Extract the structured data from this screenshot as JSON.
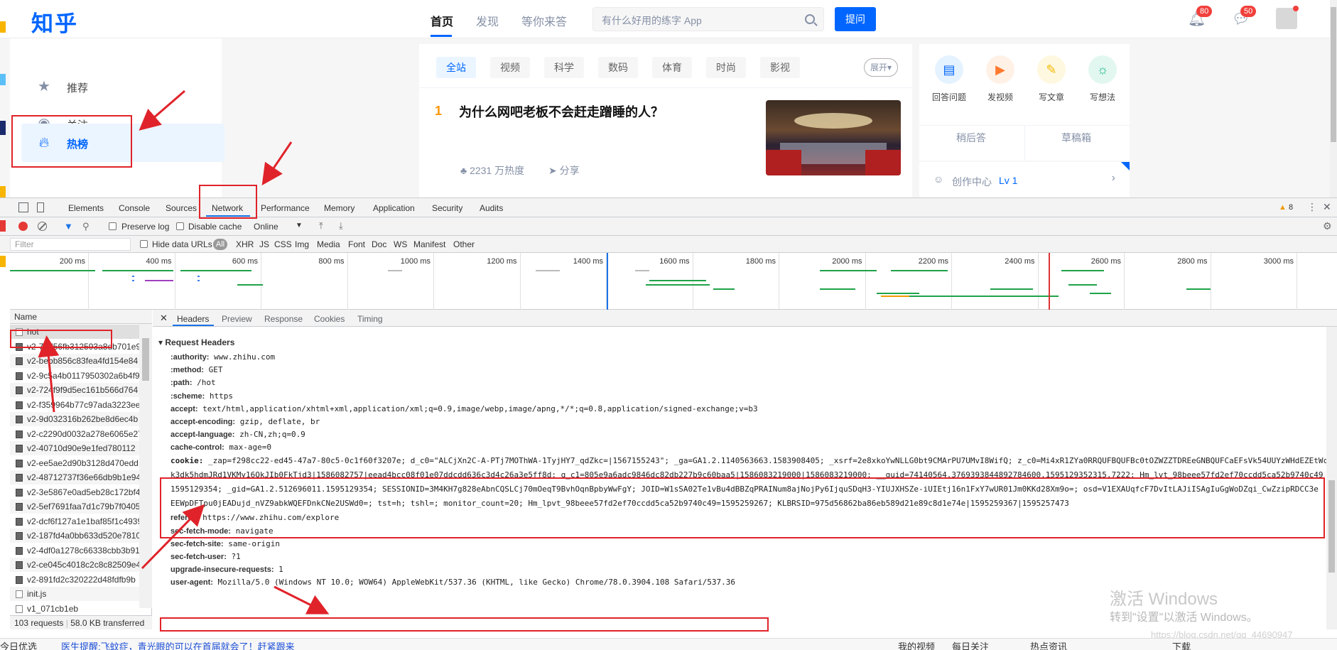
{
  "zhihu": {
    "logo": "知乎",
    "nav": [
      {
        "label": "首页"
      },
      {
        "label": "发现"
      },
      {
        "label": "等你来答"
      }
    ],
    "search_placeholder": "有什么好用的练字 App",
    "ask_button": "提问",
    "notifications_count": "80",
    "messages_count": "50",
    "sidebar": [
      {
        "label": "推荐"
      },
      {
        "label": "关注"
      },
      {
        "label": "热榜"
      }
    ],
    "tabs": [
      {
        "label": "全站"
      },
      {
        "label": "视频"
      },
      {
        "label": "科学"
      },
      {
        "label": "数码"
      },
      {
        "label": "体育"
      },
      {
        "label": "时尚"
      },
      {
        "label": "影视"
      }
    ],
    "expand_button": "展开",
    "hot_item": {
      "rank": "1",
      "title": "为什么网吧老板不会赶走蹭睡的人？",
      "heat": "2231 万热度",
      "share": "分享"
    },
    "actions": [
      {
        "label": "回答问题"
      },
      {
        "label": "发视频"
      },
      {
        "label": "写文章"
      },
      {
        "label": "写想法"
      }
    ],
    "later_answer": "稍后答",
    "drafts": "草稿箱",
    "creator_center": "创作中心",
    "creator_level": "Lv 1"
  },
  "devtools": {
    "tabs": [
      {
        "label": "Elements"
      },
      {
        "label": "Console"
      },
      {
        "label": "Sources"
      },
      {
        "label": "Network"
      },
      {
        "label": "Performance"
      },
      {
        "label": "Memory"
      },
      {
        "label": "Application"
      },
      {
        "label": "Security"
      },
      {
        "label": "Audits"
      }
    ],
    "warning_count": "8",
    "toolbar": {
      "preserve_log": "Preserve log",
      "disable_cache": "Disable cache",
      "throttling": "Online"
    },
    "filter": {
      "placeholder": "Filter",
      "hide_data_urls": "Hide data URLs",
      "all": "All",
      "types": [
        "XHR",
        "JS",
        "CSS",
        "Img",
        "Media",
        "Font",
        "Doc",
        "WS",
        "Manifest",
        "Other"
      ]
    },
    "overview_ticks": [
      "200 ms",
      "400 ms",
      "600 ms",
      "800 ms",
      "1000 ms",
      "1200 ms",
      "1400 ms",
      "1600 ms",
      "1800 ms",
      "2000 ms",
      "2200 ms",
      "2400 ms",
      "2600 ms",
      "2800 ms",
      "3000 ms"
    ],
    "list": {
      "header": "Name",
      "rows": [
        "hot",
        "v2-77d56fb312593a8db701e9",
        "v2-bebb856c83fea4fd154e84",
        "v2-9c5a4b0117950302a6b4f9",
        "v2-724f9f9d5ec161b566d764",
        "v2-f359964b77c97ada3223ee",
        "v2-9d032316b262be8d6ec4b",
        "v2-c2290d0032a278e6065e27",
        "v2-40710d90e9e1fed780112",
        "v2-ee5ae2d90b3128d470edd",
        "v2-48712737f36e66db9b1e94",
        "v2-3e5867e0ad5eb28c172bf4",
        "v2-5ef7691faa7d1c79b7f0405",
        "v2-dcf6f127a1e1baf85f1c4939",
        "v2-187fd4a0bb633d520e7810",
        "v2-4df0a1278c66338cbb3b91",
        "v2-ce045c4018c2c8c82509e4",
        "v2-891fd2c320222d48fdfb9b",
        "init.js",
        "v1_071cb1eb"
      ],
      "requests": "103 requests",
      "transferred": "58.0 KB transferred"
    },
    "detail": {
      "tabs": [
        {
          "label": "Headers"
        },
        {
          "label": "Preview"
        },
        {
          "label": "Response"
        },
        {
          "label": "Cookies"
        },
        {
          "label": "Timing"
        }
      ],
      "section": "Request Headers",
      "headers": [
        {
          "key": ":authority:",
          "value": "www.zhihu.com"
        },
        {
          "key": ":method:",
          "value": "GET"
        },
        {
          "key": ":path:",
          "value": "/hot"
        },
        {
          "key": ":scheme:",
          "value": "https"
        },
        {
          "key": "accept:",
          "value": "text/html,application/xhtml+xml,application/xml;q=0.9,image/webp,image/apng,*/*;q=0.8,application/signed-exchange;v=b3"
        },
        {
          "key": "accept-encoding:",
          "value": "gzip, deflate, br"
        },
        {
          "key": "accept-language:",
          "value": "zh-CN,zh;q=0.9"
        },
        {
          "key": "cache-control:",
          "value": "max-age=0"
        }
      ],
      "cookie_key": "cookie:",
      "cookie_lines": [
        "_zap=f298cc22-ed45-47a7-80c5-0c1f60f3207e; d_c0=\"ALCjXn2C-A-PTj7MOThWA-1TyjHY7_qdZkc=|1567155243\"; _ga=GA1.2.1140563663.1583908405; _xsrf=2e8xkoYwNLLG0bt9CMArPU7UMvI8WifQ; z_c0=Mi4xR1ZYa0RRQUFBQUFBc0tOZWZZTDREeGNBQUFCaEFsVk54UUYzWHdEZEtWcm",
        "k3dk5hdmJRd1VKMy16QkJIb0FkTjd3|1586082757|eead4bcc08f01e07ddcdd636c3d4c26a3e5ff8d; q_c1=805e9a6adc9846dc82db227b9c60baa5|1586083219000|1586083219000; __guid=74140564.3769393844892784600.1595129352315.7222; Hm_lvt_98beee57fd2ef70ccdd5ca52b9740c49",
        "1595129354; _gid=GA1.2.512696011.1595129354; SESSIONID=3M4KH7g828eAbnCQSLCj70mOeqT9BvhOqnBpbyWwFgY; JOID=W1sSA02Te1vBu4dBBZqPRAINum8ajNojPy6IjquSDqH3-YIUJXHSZe-iUIEtj16n1FxY7wUR01Jm0KKd28Xm9o=; osd=V1EXAUqfcF7DvItLAJiISAgIuGgWoDZqi_CwZzipRDCC3e",
        "EEWpDFTpu0jEADujd_nVZ9abkWQEFDnkCNe2USWd0=; tst=h; tshl=; monitor_count=20; Hm_lpvt_98beee57fd2ef70ccdd5ca52b9740c49=1595259267; KLBRSID=975d56862ba86eb589d21e89c8d1e74e|1595259367|1595257473"
      ],
      "headers2": [
        {
          "key": "referer:",
          "value": "https://www.zhihu.com/explore"
        },
        {
          "key": "sec-fetch-mode:",
          "value": "navigate"
        },
        {
          "key": "sec-fetch-site:",
          "value": "same-origin"
        },
        {
          "key": "sec-fetch-user:",
          "value": "?1"
        },
        {
          "key": "upgrade-insecure-requests:",
          "value": "1"
        },
        {
          "key": "user-agent:",
          "value": "Mozilla/5.0 (Windows NT 10.0; WOW64) AppleWebKit/537.36 (KHTML, like Gecko) Chrome/78.0.3904.108 Safari/537.36"
        }
      ]
    }
  },
  "watermark": {
    "line1": "激活 Windows",
    "line2": "转到\"设置\"以激活 Windows。",
    "csdn": "https://blog.csdn.net/qq_44690947"
  },
  "taskbar": {
    "left": "今日优选",
    "news": "医生提醒:飞蚊症，青光眼的可以在首届就会了！赶紧跟来",
    "my_videos": "我的视频",
    "daily_focus": "每日关注",
    "hot_news": "热点资讯",
    "download": "下载"
  },
  "colors": {
    "zhihu_blue": "#0066ff",
    "annotation_red": "#e0232a",
    "devtools_blue": "#1a73e8"
  }
}
